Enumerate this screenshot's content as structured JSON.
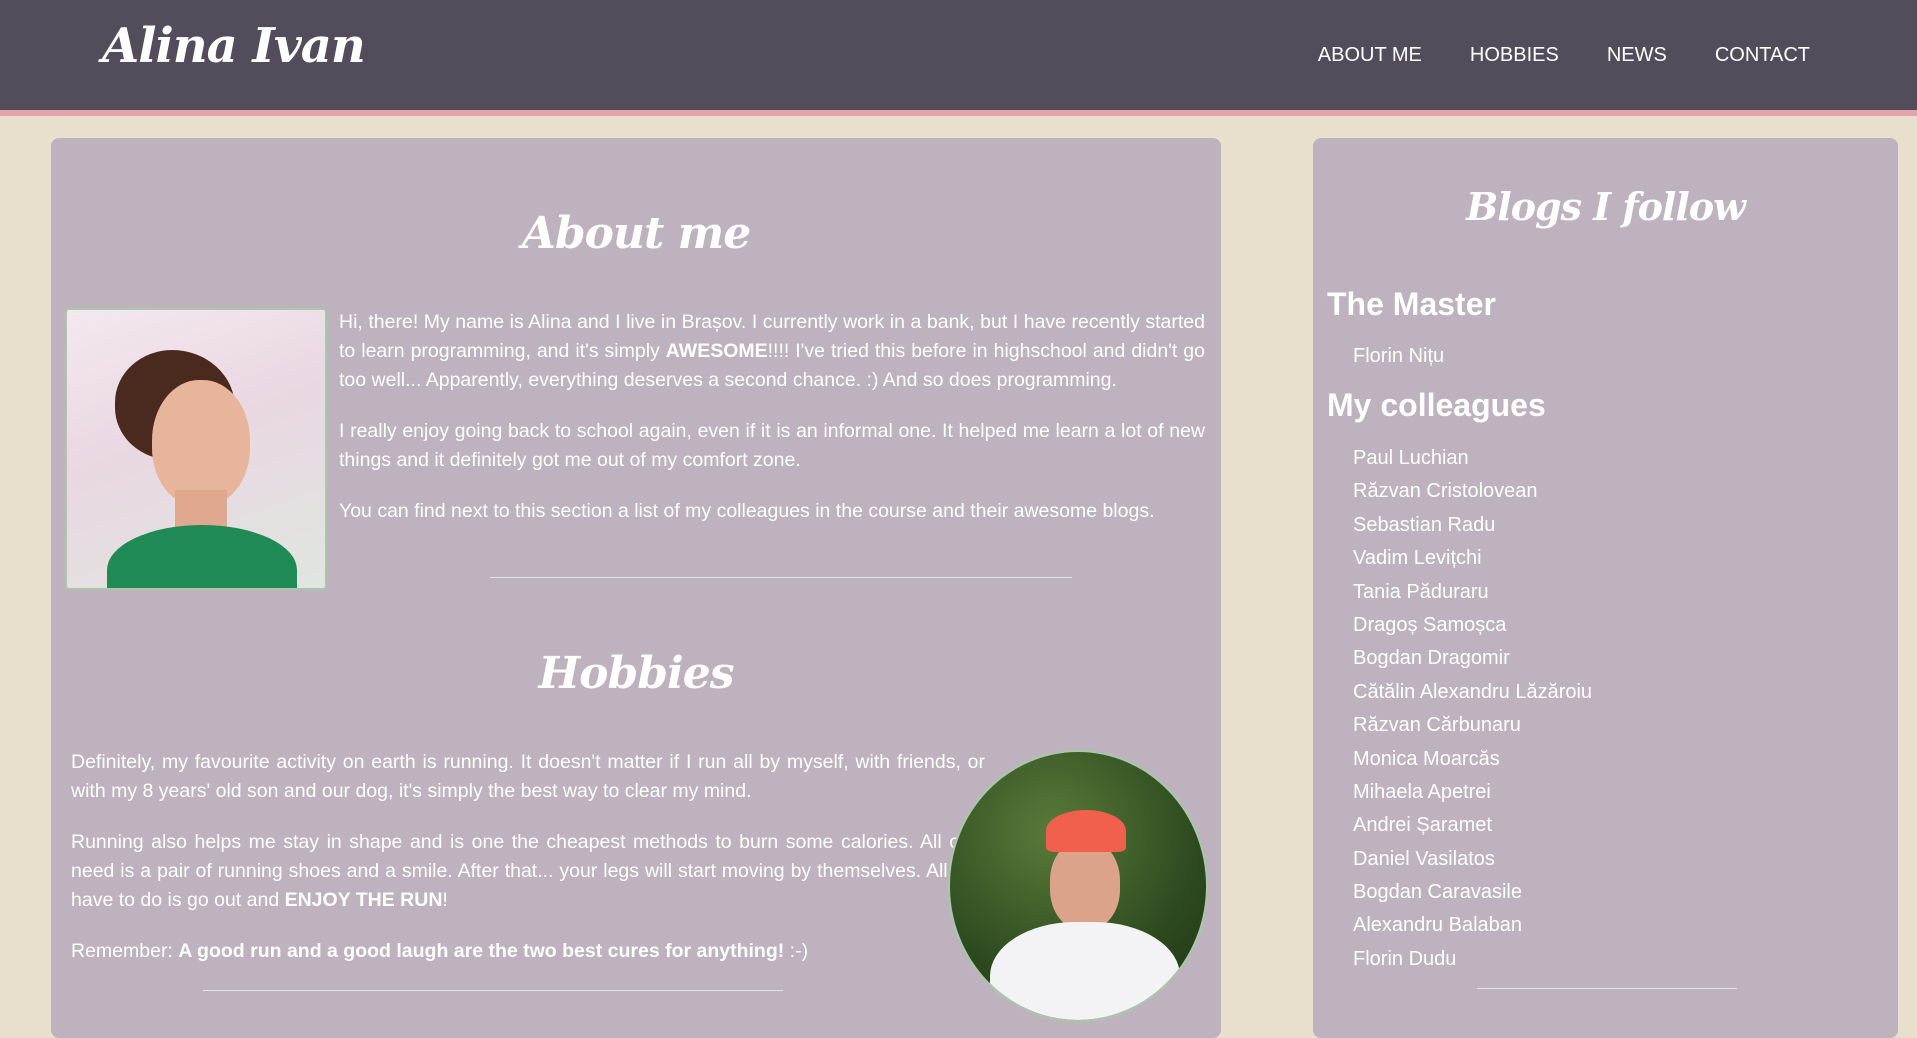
{
  "header": {
    "logo": "Alina Ivan",
    "nav": [
      "ABOUT ME",
      "HOBBIES",
      "NEWS",
      "CONTACT"
    ]
  },
  "about": {
    "title": "About me",
    "p1_before": "Hi, there! My name is Alina and I live in Brașov. I currently work in a bank, but I have recently started to learn programming, and it's simply ",
    "p1_bold": "AWESOME",
    "p1_after": "!!!! I've tried this before in highschool and didn't go too well... Apparently, everything deserves a second chance. :) And so does programming.",
    "p2": "I really enjoy going back to school again, even if it is an informal one. It helped me learn a lot of new things and it definitely got me out of my comfort zone.",
    "p3": "You can find next to this section a list of my colleagues in the course and their awesome blogs."
  },
  "hobbies": {
    "title": "Hobbies",
    "p1": "Definitely, my favourite activity on earth is running. It doesn't matter if I run all by myself, with friends, or with my 8 years' old son and our dog, it's simply the best way to clear my mind.",
    "p2_before": "Running also helps me stay in shape and is one the cheapest methods to burn some calories. All only need is a pair of running shoes and a smile. After that... your legs will start moving by themselves. All you have to do is go out and ",
    "p2_bold": "ENJOY THE RUN",
    "p2_after": "!",
    "p3_before": "Remember: ",
    "p3_bold": "A good run and a good laugh are the two best cures for anything!",
    "p3_after": " :-)"
  },
  "sidebar": {
    "title": "Blogs I follow",
    "master_heading": "The Master",
    "master": [
      "Florin Nițu"
    ],
    "colleagues_heading": "My colleagues",
    "colleagues": [
      "Paul Luchian",
      "Răzvan Cristolovean",
      "Sebastian Radu",
      "Vadim Levițchi",
      "Tania Păduraru",
      "Dragoș Samoșca",
      "Bogdan Dragomir",
      "Cătălin Alexandru Lăzăroiu",
      "Răzvan Cărbunaru",
      "Monica Moarcăs",
      "Mihaela Apetrei",
      "Andrei Șaramet",
      "Daniel Vasilatos",
      "Bogdan Caravasile",
      "Alexandru Balaban",
      "Florin Dudu"
    ]
  },
  "colors": {
    "header_bg": "#534c5b",
    "header_accent": "#e3a3ab",
    "page_bg": "#e9dfcd",
    "panel_bg": "#bdb2be",
    "text": "#ffffff"
  }
}
